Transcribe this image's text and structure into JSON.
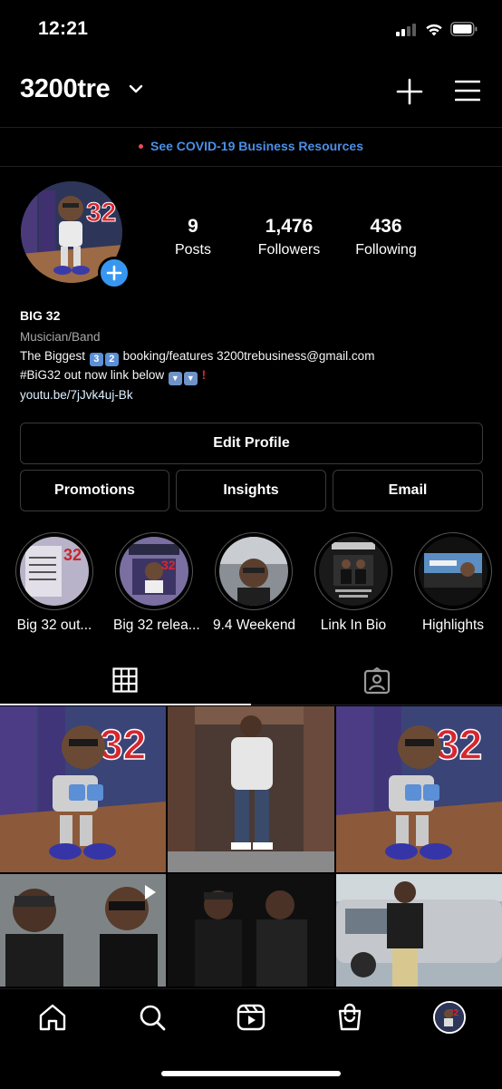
{
  "status_bar": {
    "time": "12:21"
  },
  "header": {
    "username": "3200tre"
  },
  "banner": {
    "text": "See COVID-19 Business Resources"
  },
  "stats": [
    {
      "value": "9",
      "label": "Posts"
    },
    {
      "value": "1,476",
      "label": "Followers"
    },
    {
      "value": "436",
      "label": "Following"
    }
  ],
  "bio": {
    "name": "BIG 32",
    "category": "Musician/Band",
    "line1_prefix": "The Biggest",
    "emoji_digits": [
      "3",
      "2"
    ],
    "line1_suffix": "booking/features 3200trebusiness@gmail.com",
    "line2_prefix": "#BiG32 out now link below",
    "emoji_arrows": [
      "▼",
      "▼"
    ],
    "line2_suffix": "!",
    "link": "youtu.be/7jJvk4uj-Bk"
  },
  "buttons": {
    "edit_profile": "Edit Profile",
    "promotions": "Promotions",
    "insights": "Insights",
    "email": "Email"
  },
  "highlights": [
    {
      "label": "Big 32 out..."
    },
    {
      "label": "Big 32 relea..."
    },
    {
      "label": "9.4 Weekend"
    },
    {
      "label": "Link In Bio"
    },
    {
      "label": "Highlights"
    }
  ],
  "icons": {
    "grid_tab": "grid-icon",
    "tagged_tab": "tagged-icon",
    "nav": [
      "home-icon",
      "search-icon",
      "reels-icon",
      "shop-icon",
      "profile-avatar"
    ]
  },
  "colors": {
    "accent": "#3797f0",
    "link_blue": "#4a8fe7",
    "banner_dot": "#ed4956"
  }
}
